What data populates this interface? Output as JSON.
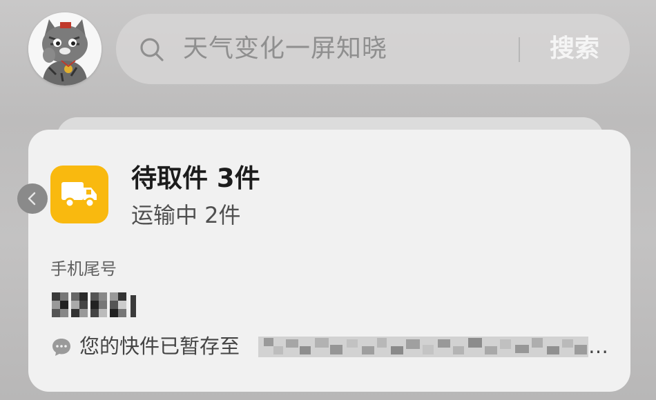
{
  "search": {
    "placeholder": "天气变化一屏知晓",
    "button_label": "搜索"
  },
  "card": {
    "title": "待取件 3件",
    "subtitle": "运输中 2件",
    "phone_label": "手机尾号",
    "message_prefix": "您的快件已暂存至",
    "ellipsis": "…",
    "icon": "delivery-truck-icon",
    "icon_color": "#f9b90f"
  },
  "profile": {
    "avatar": "cat-avatar"
  }
}
